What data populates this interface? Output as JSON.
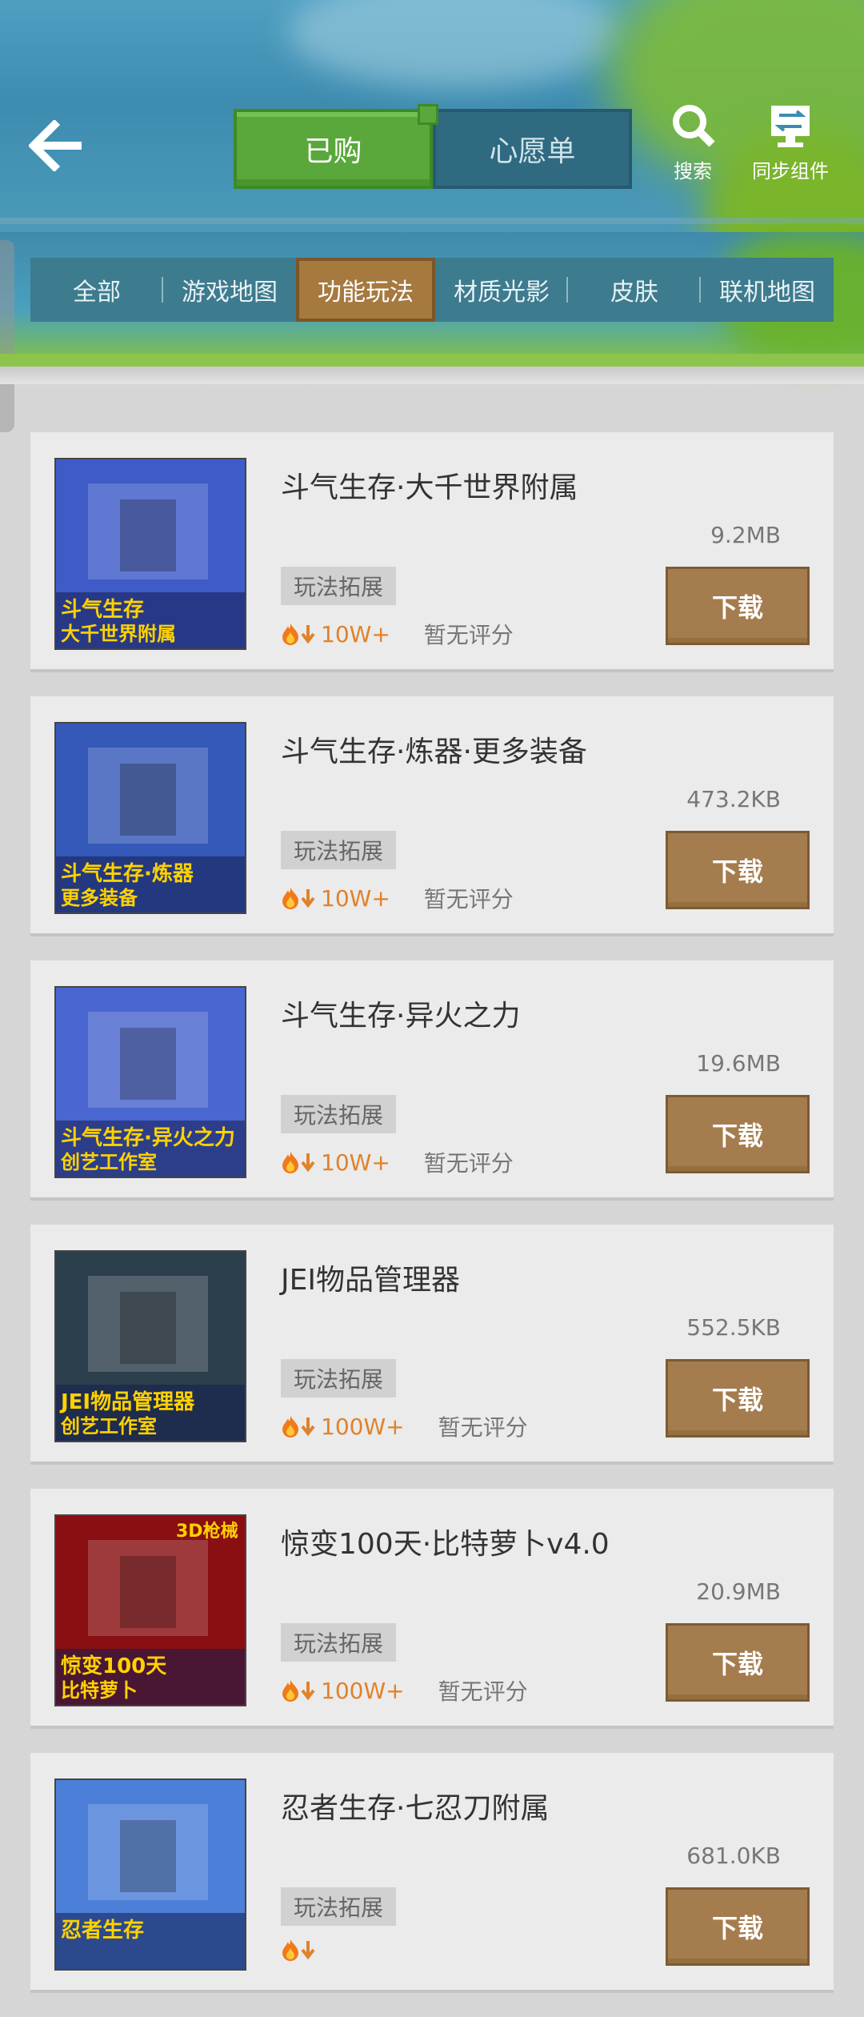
{
  "header": {
    "segment": {
      "active": "已购",
      "inactive": "心愿单"
    },
    "search_label": "搜索",
    "sync_label": "同步组件"
  },
  "tabs": [
    "全部",
    "游戏地图",
    "功能玩法",
    "材质光影",
    "皮肤",
    "联机地图"
  ],
  "active_tab": "功能玩法",
  "download_label": "下载",
  "items": [
    {
      "title": "斗气生存·大千世界附属",
      "size": "9.2MB",
      "tag": "玩法拓展",
      "downloads": "10W+",
      "rating": "暂无评分",
      "thumb": {
        "line1": "斗气生存",
        "line2": "大千世界附属",
        "bg": "#3f5bc8"
      }
    },
    {
      "title": "斗气生存·炼器·更多装备",
      "size": "473.2KB",
      "tag": "玩法拓展",
      "downloads": "10W+",
      "rating": "暂无评分",
      "thumb": {
        "line1": "斗气生存·炼器",
        "line2": "更多装备",
        "bg": "#3559b8"
      }
    },
    {
      "title": "斗气生存·异火之力",
      "size": "19.6MB",
      "tag": "玩法拓展",
      "downloads": "10W+",
      "rating": "暂无评分",
      "thumb": {
        "line1": "斗气生存·异火之力",
        "line2": "创艺工作室",
        "bg": "#4a66d0"
      }
    },
    {
      "title": "JEI物品管理器",
      "size": "552.5KB",
      "tag": "玩法拓展",
      "downloads": "100W+",
      "rating": "暂无评分",
      "thumb": {
        "line1": "JEI物品管理器",
        "line2": "创艺工作室",
        "bg": "#2c3f4c"
      }
    },
    {
      "title": "惊变100天·比特萝卜v4.0",
      "size": "20.9MB",
      "tag": "玩法拓展",
      "downloads": "100W+",
      "rating": "暂无评分",
      "thumb": {
        "line1": "惊变100天",
        "line2": "比特萝卜",
        "corner": "3D枪械",
        "bg": "#8a0f12"
      }
    },
    {
      "title": "忍者生存·七忍刀附属",
      "size": "681.0KB",
      "tag": "玩法拓展",
      "downloads": "",
      "rating": "",
      "thumb": {
        "line1": "忍者生存",
        "line2": "",
        "bg": "#4b7fd8"
      }
    }
  ]
}
